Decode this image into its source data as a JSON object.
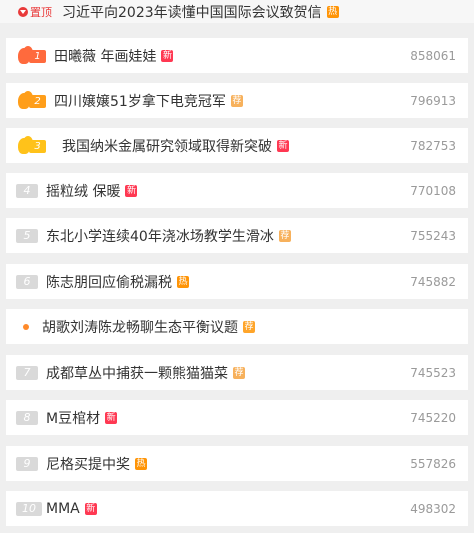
{
  "pinned": {
    "label": "置顶",
    "title": "习近平向2023年读懂中国国际会议致贺信",
    "tag": "热"
  },
  "items": [
    {
      "rank": "1",
      "title": "田曦薇 年画娃娃",
      "tag": "新",
      "count": "858061"
    },
    {
      "rank": "2",
      "title": "四川嬢嬢51岁拿下电竞冠军",
      "tag": "荐",
      "count": "796913"
    },
    {
      "rank": "3",
      "title": "我国纳米金属研究领域取得新突破",
      "tag": "新",
      "count": "782753"
    },
    {
      "rank": "4",
      "title": "摇粒绒 保暖",
      "tag": "新",
      "count": "770108"
    },
    {
      "rank": "5",
      "title": "东北小学连续40年浇冰场教学生滑冰",
      "tag": "荐",
      "count": "755243"
    },
    {
      "rank": "6",
      "title": "陈志朋回应偷税漏税",
      "tag": "热",
      "count": "745882"
    },
    {
      "rank": "",
      "title": "胡歌刘涛陈龙畅聊生态平衡议题",
      "tag": "荐",
      "count": ""
    },
    {
      "rank": "7",
      "title": "成都草丛中捕获一颗熊猫猫菜",
      "tag": "荐",
      "count": "745523"
    },
    {
      "rank": "8",
      "title": "M豆棺材",
      "tag": "新",
      "count": "745220"
    },
    {
      "rank": "9",
      "title": "尼格买提中奖",
      "tag": "热",
      "count": "557826"
    },
    {
      "rank": "10",
      "title": "MMA",
      "tag": "新",
      "count": "498302"
    }
  ],
  "colors": {
    "new": "#ff3852",
    "hot": "#ff9406",
    "rec": "#ffa52a",
    "rank1": "#ff6a3d",
    "rank2": "#ff9e1a",
    "rank3": "#ffc21a"
  }
}
